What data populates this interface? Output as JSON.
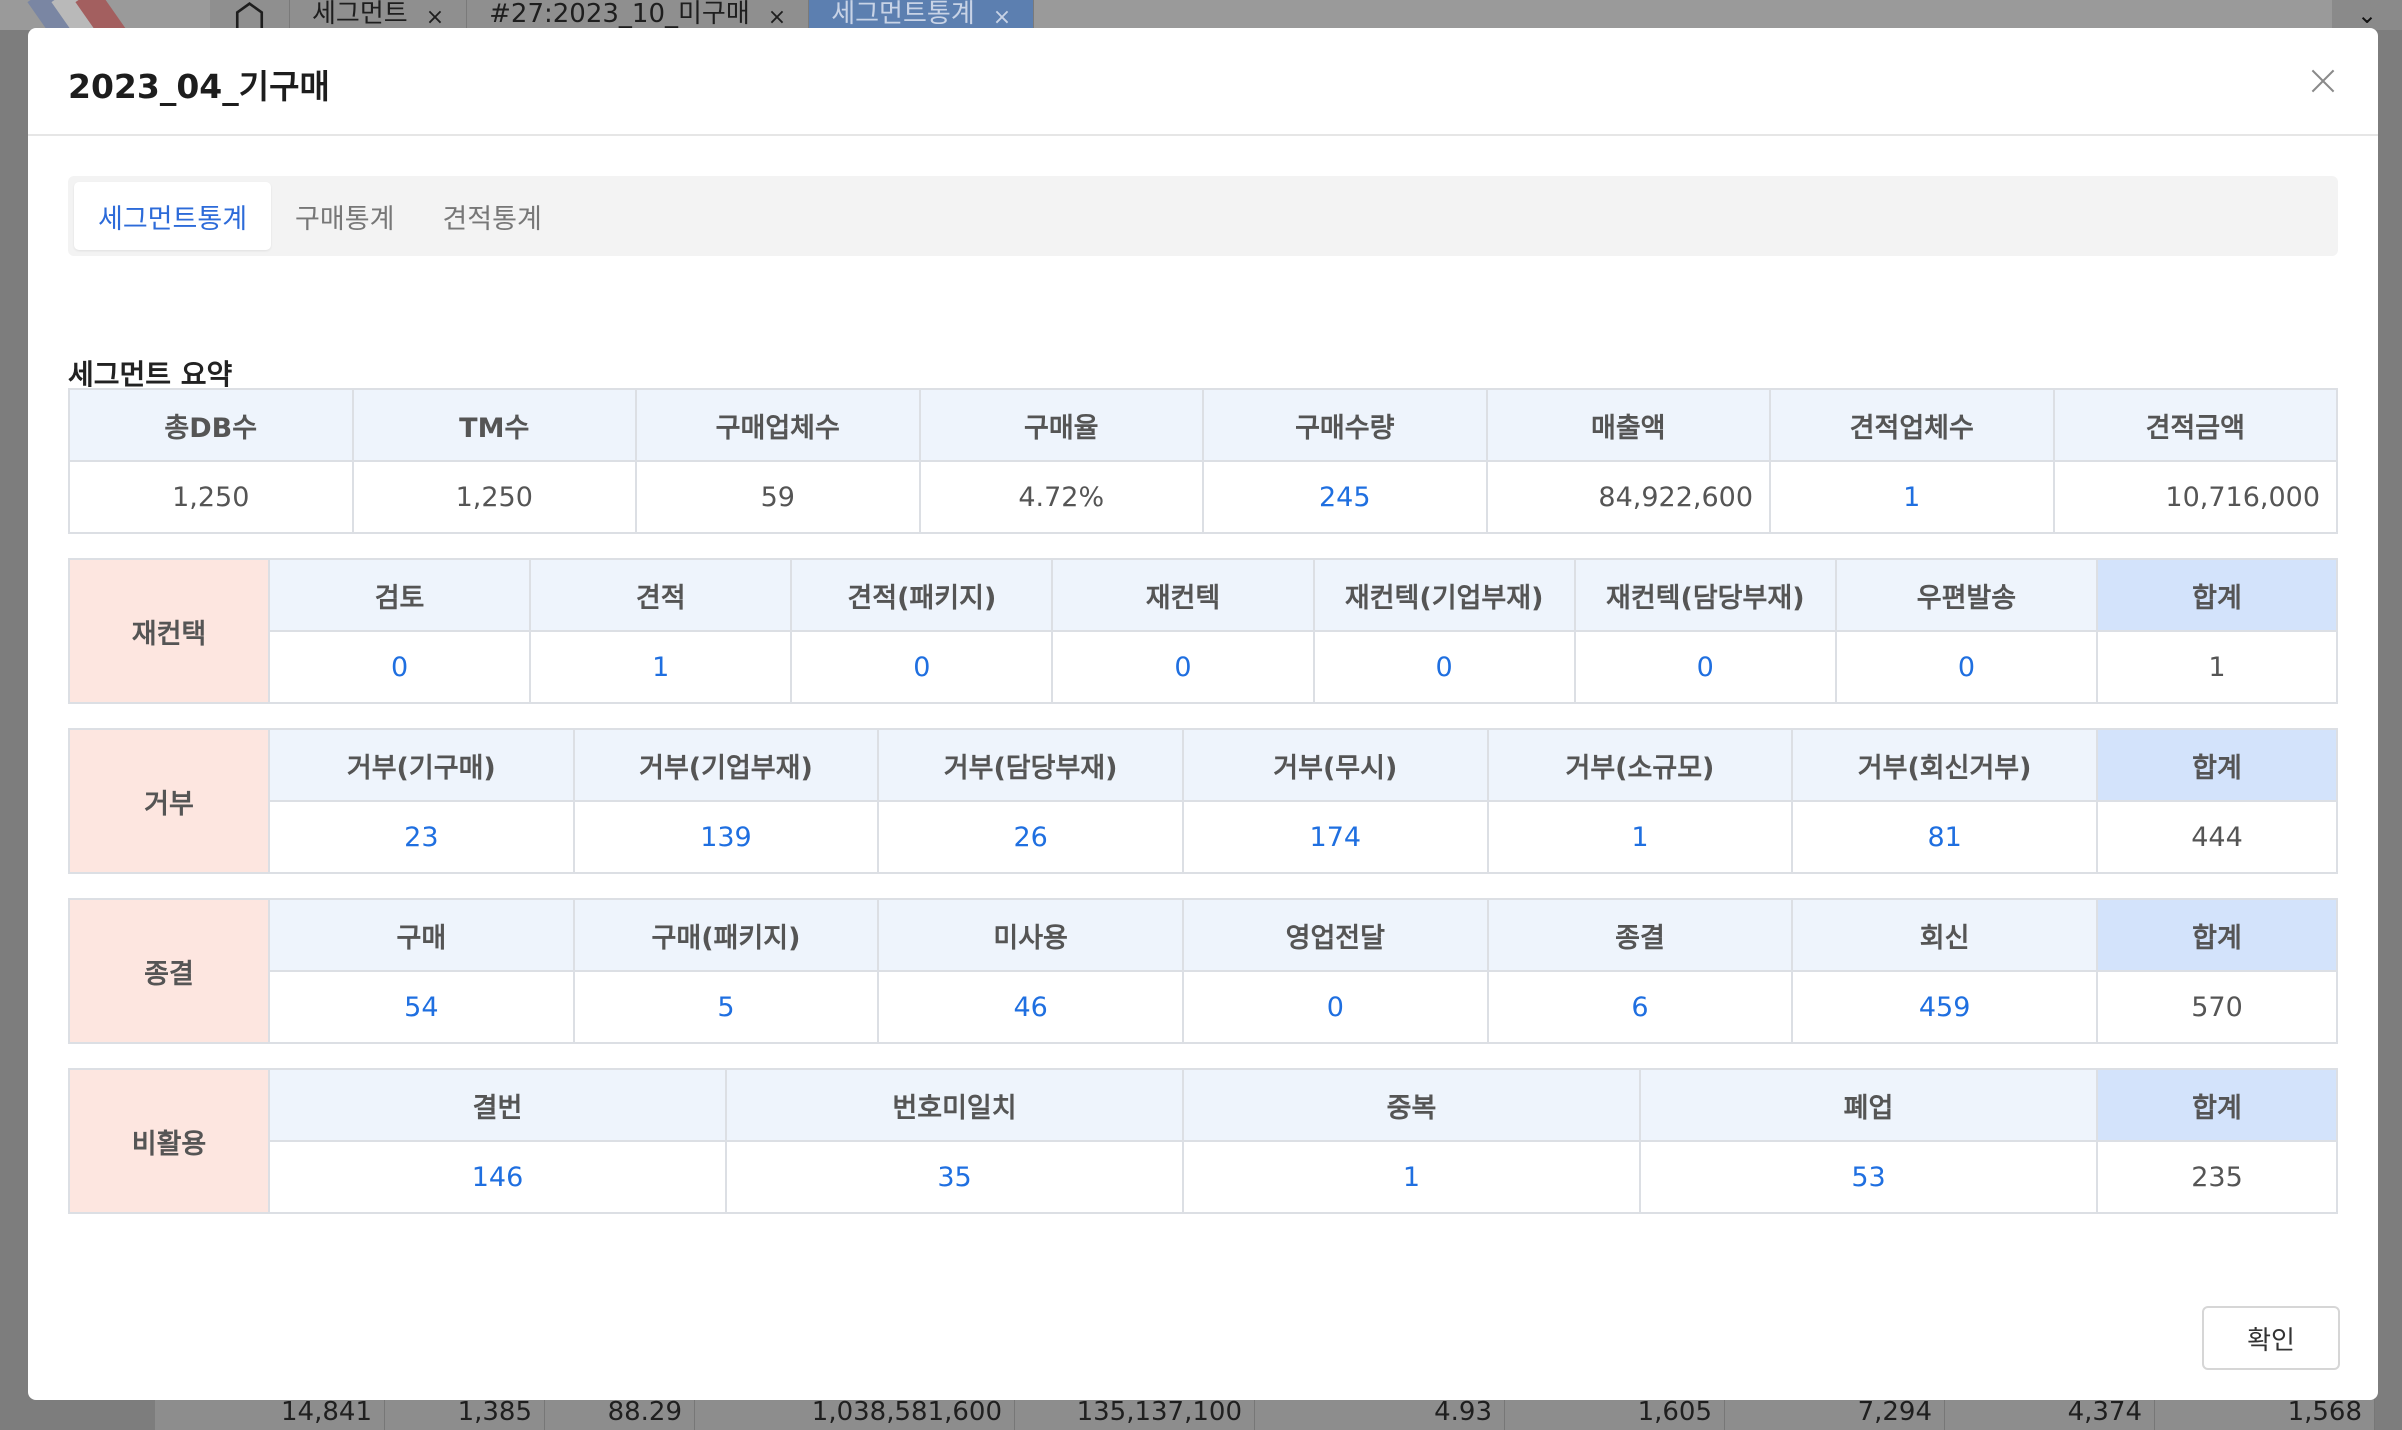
{
  "background": {
    "tabs": [
      {
        "label": "세그먼트",
        "close": "×"
      },
      {
        "label": "#27:2023_10_미구매",
        "close": "×"
      },
      {
        "label": "세그먼트통계",
        "close": "×"
      }
    ],
    "chevron": "⌄",
    "row_values": [
      "14,841",
      "1,385",
      "88.29",
      "1,038,581,600",
      "135,137,100",
      "4.93",
      "1,605",
      "7,294",
      "4,374",
      "1,568"
    ]
  },
  "modal": {
    "title": "2023_04_기구매",
    "tabs": [
      "세그먼트통계",
      "구매통계",
      "견적통계"
    ],
    "active_tab": 0,
    "section_title": "세그먼트 요약",
    "summary": {
      "headers": [
        "총DB수",
        "TM수",
        "구매업체수",
        "구매율",
        "구매수량",
        "매출액",
        "견적업체수",
        "견적금액"
      ],
      "values": [
        "1,250",
        "1,250",
        "59",
        "4.72%",
        "245",
        "84,922,600",
        "1",
        "10,716,000"
      ]
    },
    "recontact": {
      "category": "재컨택",
      "headers": [
        "검토",
        "견적",
        "견적(패키지)",
        "재컨텍",
        "재컨텍(기업부재)",
        "재컨텍(담당부재)",
        "우편발송",
        "합계"
      ],
      "values": [
        "0",
        "1",
        "0",
        "0",
        "0",
        "0",
        "0",
        "1"
      ]
    },
    "reject": {
      "category": "거부",
      "headers": [
        "거부(기구매)",
        "거부(기업부재)",
        "거부(담당부재)",
        "거부(무시)",
        "거부(소규모)",
        "거부(회신거부)",
        "합계"
      ],
      "values": [
        "23",
        "139",
        "26",
        "174",
        "1",
        "81",
        "444"
      ]
    },
    "closed": {
      "category": "종결",
      "headers": [
        "구매",
        "구매(패키지)",
        "미사용",
        "영업전달",
        "종결",
        "회신",
        "합계"
      ],
      "values": [
        "54",
        "5",
        "46",
        "0",
        "6",
        "459",
        "570"
      ]
    },
    "inactive": {
      "category": "비활용",
      "headers": [
        "결번",
        "번호미일치",
        "중복",
        "폐업",
        "합계"
      ],
      "values": [
        "146",
        "35",
        "1",
        "53",
        "235"
      ]
    },
    "confirm_label": "확인"
  }
}
